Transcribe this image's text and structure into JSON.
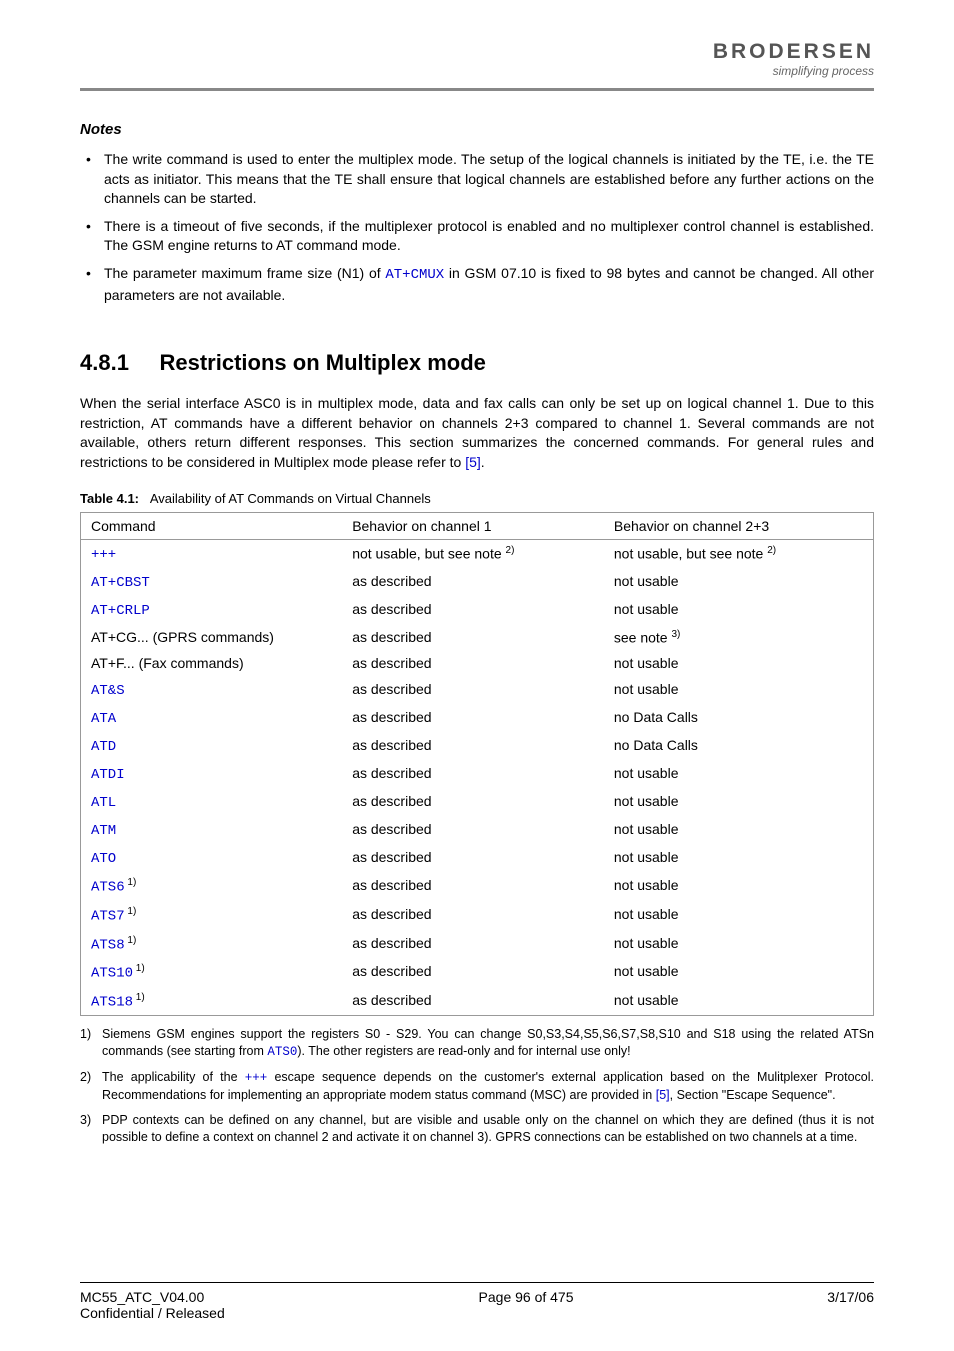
{
  "header": {
    "logo": "BRODERSEN",
    "tagline": "simplifying process"
  },
  "notes": {
    "heading": "Notes",
    "items": [
      {
        "pre": "The write command is used to enter the multiplex mode. The setup of the logical channels is initiated by the TE, i.e. the TE acts as initiator. This means that the TE shall ensure that logical channels are established before any further actions on the channels can be started."
      },
      {
        "pre": "There is a timeout of five seconds, if the multiplexer protocol is enabled and no multiplexer control channel is established. The GSM engine returns to AT command mode."
      },
      {
        "pre": "The parameter maximum frame size (N1) of ",
        "code": "AT+CMUX",
        "post": " in GSM 07.10 is fixed to 98 bytes and cannot be changed. All other parameters are not available."
      }
    ]
  },
  "section": {
    "number": "4.8.1",
    "title": "Restrictions on Multiplex mode",
    "para_pre": "When the serial interface ASC0 is in multiplex mode, data and fax calls can only be set up on logical channel 1. Due to this restriction, AT commands have a different behavior on channels 2+3 compared to channel 1. Several commands are not available, others return different responses. This section summarizes the concerned commands. For general rules and restrictions to be considered in Multiplex mode please refer to ",
    "para_link": "[5]",
    "para_post": "."
  },
  "table": {
    "caption_label": "Table 4.1:",
    "caption_text": "Availability of AT Commands on Virtual Channels",
    "headers": [
      "Command",
      "Behavior on channel 1",
      "Behavior on channel 2+3"
    ],
    "rows": [
      {
        "cmd": "+++",
        "mono": true,
        "sup": "",
        "ch1": "not usable, but see note ",
        "ch1sup": "2)",
        "ch23": "not usable, but see note ",
        "ch23sup": "2)"
      },
      {
        "cmd": "AT+CBST",
        "mono": true,
        "sup": "",
        "ch1": "as described",
        "ch1sup": "",
        "ch23": "not usable",
        "ch23sup": ""
      },
      {
        "cmd": "AT+CRLP",
        "mono": true,
        "sup": "",
        "ch1": "as described",
        "ch1sup": "",
        "ch23": "not usable",
        "ch23sup": ""
      },
      {
        "cmd": "AT+CG... (GPRS commands)",
        "mono": false,
        "sup": "",
        "ch1": "as described",
        "ch1sup": "",
        "ch23": "see note ",
        "ch23sup": "3)"
      },
      {
        "cmd": "AT+F... (Fax commands)",
        "mono": false,
        "sup": "",
        "ch1": "as described",
        "ch1sup": "",
        "ch23": "not usable",
        "ch23sup": ""
      },
      {
        "cmd": "AT&S",
        "mono": true,
        "sup": "",
        "ch1": "as described",
        "ch1sup": "",
        "ch23": "not usable",
        "ch23sup": ""
      },
      {
        "cmd": "ATA",
        "mono": true,
        "sup": "",
        "ch1": "as described",
        "ch1sup": "",
        "ch23": "no Data Calls",
        "ch23sup": ""
      },
      {
        "cmd": "ATD",
        "mono": true,
        "sup": "",
        "ch1": "as described",
        "ch1sup": "",
        "ch23": "no Data Calls",
        "ch23sup": ""
      },
      {
        "cmd": "ATDI",
        "mono": true,
        "sup": "",
        "ch1": "as described",
        "ch1sup": "",
        "ch23": "not usable",
        "ch23sup": ""
      },
      {
        "cmd": "ATL",
        "mono": true,
        "sup": "",
        "ch1": "as described",
        "ch1sup": "",
        "ch23": "not usable",
        "ch23sup": ""
      },
      {
        "cmd": "ATM",
        "mono": true,
        "sup": "",
        "ch1": "as described",
        "ch1sup": "",
        "ch23": "not usable",
        "ch23sup": ""
      },
      {
        "cmd": "ATO",
        "mono": true,
        "sup": "",
        "ch1": "as described",
        "ch1sup": "",
        "ch23": "not usable",
        "ch23sup": ""
      },
      {
        "cmd": "ATS6",
        "mono": true,
        "sup": "1)",
        "ch1": "as described",
        "ch1sup": "",
        "ch23": "not usable",
        "ch23sup": ""
      },
      {
        "cmd": "ATS7",
        "mono": true,
        "sup": "1)",
        "ch1": "as described",
        "ch1sup": "",
        "ch23": "not usable",
        "ch23sup": ""
      },
      {
        "cmd": "ATS8",
        "mono": true,
        "sup": "1)",
        "ch1": "as described",
        "ch1sup": "",
        "ch23": "not usable",
        "ch23sup": ""
      },
      {
        "cmd": "ATS10",
        "mono": true,
        "sup": "1)",
        "ch1": "as described",
        "ch1sup": "",
        "ch23": "not usable",
        "ch23sup": ""
      },
      {
        "cmd": "ATS18",
        "mono": true,
        "sup": "1)",
        "ch1": "as described",
        "ch1sup": "",
        "ch23": "not usable",
        "ch23sup": ""
      }
    ]
  },
  "footnotes": [
    {
      "num": "1)",
      "pre": "Siemens GSM engines support the registers S0 - S29. You can change S0,S3,S4,S5,S6,S7,S8,S10 and S18 using the related ATSn commands (see starting from ",
      "code": "ATS0",
      "post": "). The other registers are read-only and for internal use only!"
    },
    {
      "num": "2)",
      "pre": "The applicability of the ",
      "code": "+++",
      "mid": " escape sequence depends on the customer's external application based on the Mulitplexer Protocol. Recommendations for implementing an appropriate modem status command (MSC) are provided in ",
      "link": "[5]",
      "post": ", Section \"Escape Sequence\"."
    },
    {
      "num": "3)",
      "pre": "PDP contexts can be defined on any channel, but are visible and usable only on the channel on which they are defined (thus it is not possible to define a context on channel 2 and activate it on channel 3). GPRS connections can be established on two channels at a time."
    }
  ],
  "footer": {
    "left1": "MC55_ATC_V04.00",
    "left2": "Confidential / Released",
    "center": "Page 96 of 475",
    "right": "3/17/06"
  }
}
